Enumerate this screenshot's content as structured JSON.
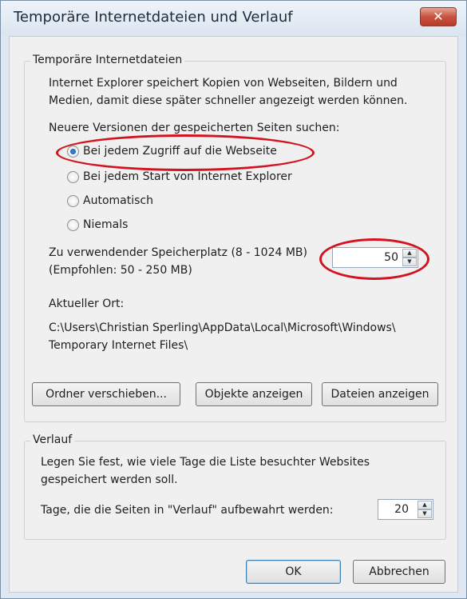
{
  "window": {
    "title": "Temporäre Internetdateien und Verlauf",
    "close_label": "✕"
  },
  "temp_files": {
    "group_label": "Temporäre Internetdateien",
    "description_line1": "Internet Explorer speichert Kopien von Webseiten, Bildern und",
    "description_line2": "Medien, damit diese später schneller angezeigt werden können.",
    "check_label": "Neuere Versionen der gespeicherten Seiten suchen:",
    "options": [
      {
        "label": "Bei jedem Zugriff auf die Webseite",
        "checked": true
      },
      {
        "label": "Bei jedem Start von Internet Explorer",
        "checked": false
      },
      {
        "label": "Automatisch",
        "checked": false
      },
      {
        "label": "Niemals",
        "checked": false
      }
    ],
    "space_label_line1": "Zu verwendender Speicherplatz (8 - 1024 MB)",
    "space_label_line2": "(Empfohlen: 50 - 250 MB)",
    "space_value": "50",
    "location_label": "Aktueller Ort:",
    "location_line1": "C:\\Users\\Christian Sperling\\AppData\\Local\\Microsoft\\Windows\\",
    "location_line2": "Temporary Internet Files\\",
    "buttons": {
      "move_folder": "Ordner verschieben...",
      "view_objects": "Objekte anzeigen",
      "view_files": "Dateien anzeigen"
    }
  },
  "history": {
    "group_label": "Verlauf",
    "description_line1": "Legen Sie fest, wie viele Tage die Liste besuchter Websites",
    "description_line2": "gespeichert werden soll.",
    "days_label": "Tage, die die Seiten in \"Verlauf\" aufbewahrt werden:",
    "days_value": "20"
  },
  "footer": {
    "ok": "OK",
    "cancel": "Abbrechen"
  },
  "annotation_color": "#d3131f"
}
